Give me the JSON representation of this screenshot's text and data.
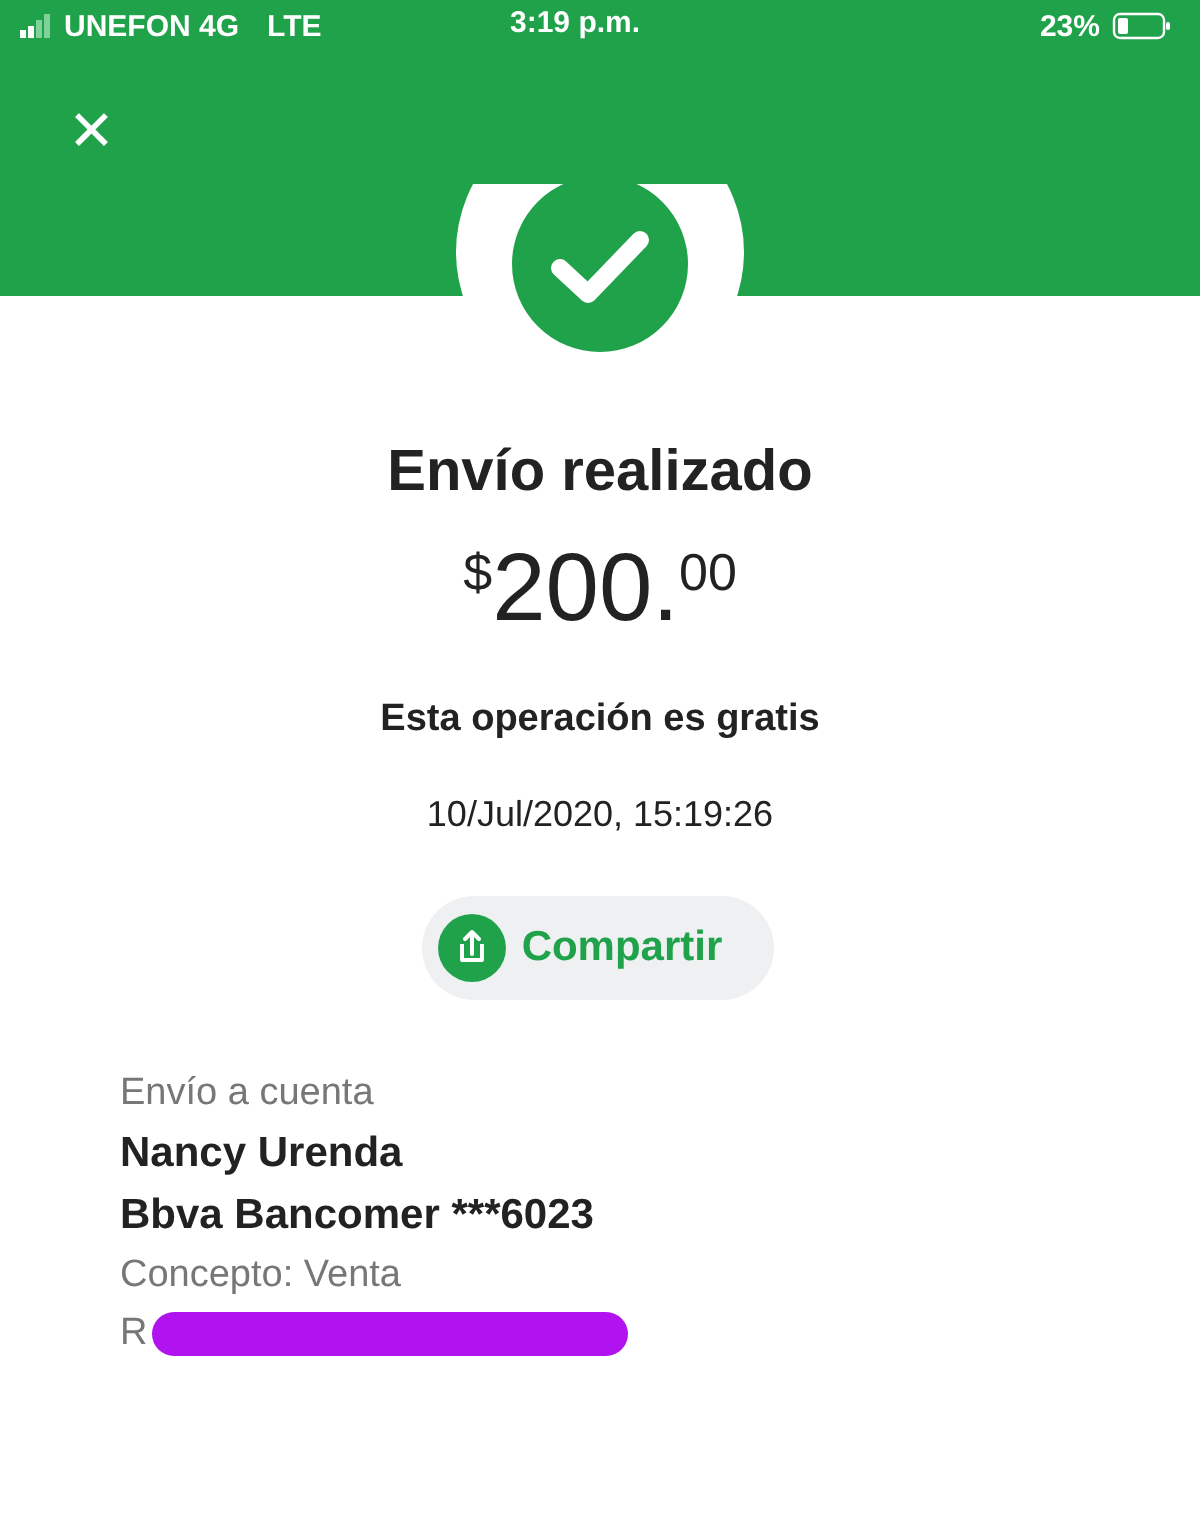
{
  "status_bar": {
    "carrier": "UNEFON 4G",
    "network": "LTE",
    "time": "3:19 p.m.",
    "battery": "23%"
  },
  "header": {
    "close": "✕"
  },
  "title": "Envío realizado",
  "amount": {
    "currency": "$",
    "whole": "200.",
    "cents": "00"
  },
  "fee_note": "Esta operación es gratis",
  "date": "10/Jul/2020, 15:19:26",
  "share_button": "Compartir",
  "details": [
    {
      "kind": "label",
      "text": "Envío a cuenta"
    },
    {
      "kind": "strong",
      "text": "Nancy Urenda"
    },
    {
      "kind": "strong",
      "text": "Bbva Bancomer ***6023"
    },
    {
      "kind": "label",
      "text": "Concepto: Venta"
    },
    {
      "kind": "redacted",
      "text": "R"
    }
  ]
}
